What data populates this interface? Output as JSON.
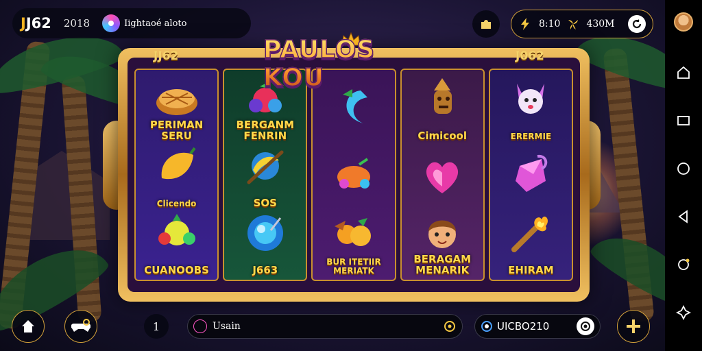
{
  "header": {
    "brand_prefix": "J",
    "brand_rest": "J62",
    "year": "2018",
    "username": "Iightaoé aloto",
    "stat_a": "8:10",
    "stat_b": "430M"
  },
  "game": {
    "title": "PAULOS KOU",
    "corner_left": "JJ62",
    "corner_right": "J062",
    "reels": [
      [
        {
          "label": "PERIMAN\nSERU",
          "icon": "pie-icon"
        },
        {
          "label": "Clicendo",
          "icon": "mango-icon"
        },
        {
          "label": "CUANOOBS",
          "icon": "fruit-bundle-icon"
        }
      ],
      [
        {
          "label": "BERGANM\nFENRIN",
          "icon": "berry-icon"
        },
        {
          "label": "SOS",
          "icon": "banana-stick-icon"
        },
        {
          "label": "J663",
          "icon": "blue-orb-icon"
        }
      ],
      [
        {
          "label": "",
          "icon": "crescent-icon"
        },
        {
          "label": "",
          "icon": "gem-fruit-icon"
        },
        {
          "label": "BUR ITETIIR\nMERIATK",
          "icon": "oranges-icon"
        }
      ],
      [
        {
          "label": "Cimicool",
          "icon": "totem-icon"
        },
        {
          "label": "",
          "icon": "heart-icon"
        },
        {
          "label": "BERAGAM\nMENARIK",
          "icon": "girl-face-icon"
        }
      ],
      [
        {
          "label": "ERERMIE",
          "icon": "cat-icon"
        },
        {
          "label": "",
          "icon": "crystal-icon"
        },
        {
          "label": "EHIRAM",
          "icon": "torch-icon"
        }
      ]
    ]
  },
  "footer": {
    "small_btn": "1",
    "search_text": "Usain",
    "id_text": "UICBO210"
  },
  "colors": {
    "gold": "#d4a23a",
    "brand_yellow": "#f5b321",
    "reel_label": "#ffd84a"
  }
}
